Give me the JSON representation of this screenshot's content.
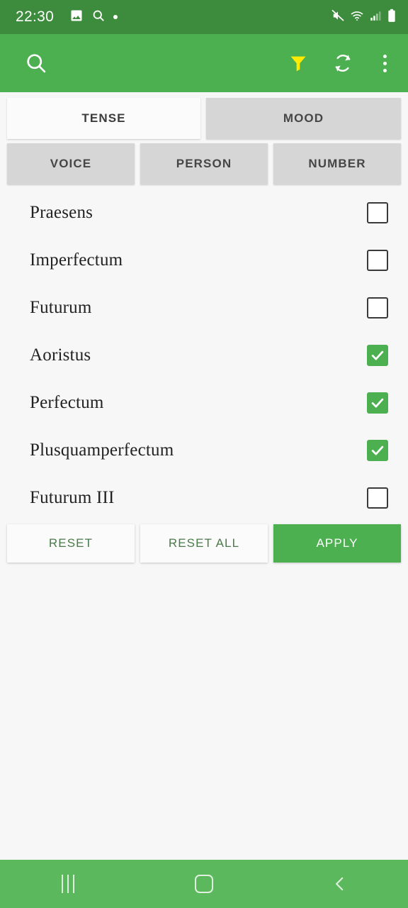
{
  "status_bar": {
    "time": "22:30",
    "left_icons": [
      "image-icon",
      "search-icon",
      "dot-indicator"
    ],
    "right_icons": [
      "mute-icon",
      "wifi-icon",
      "signal-icon",
      "battery-icon"
    ],
    "background_color": "#3d8b3d"
  },
  "app_bar": {
    "background_color": "#4caf50",
    "search_icon": "search-icon",
    "filter_icon": "filter-funnel-icon",
    "filter_color": "#ffeb00",
    "refresh_icon": "refresh-icon",
    "overflow_icon": "overflow-menu-icon"
  },
  "tabs": {
    "row1": [
      {
        "label": "TENSE",
        "selected": true
      },
      {
        "label": "MOOD",
        "selected": false
      }
    ],
    "row2": [
      {
        "label": "VOICE",
        "selected": false
      },
      {
        "label": "PERSON",
        "selected": false
      },
      {
        "label": "NUMBER",
        "selected": false
      }
    ]
  },
  "options": [
    {
      "label": "Praesens",
      "checked": false
    },
    {
      "label": "Imperfectum",
      "checked": false
    },
    {
      "label": "Futurum",
      "checked": false
    },
    {
      "label": "Aoristus",
      "checked": true
    },
    {
      "label": "Perfectum",
      "checked": true
    },
    {
      "label": "Plusquamperfectum",
      "checked": true
    },
    {
      "label": "Futurum III",
      "checked": false
    }
  ],
  "actions": [
    {
      "label": "RESET",
      "primary": false
    },
    {
      "label": "RESET ALL",
      "primary": false
    },
    {
      "label": "APPLY",
      "primary": true
    }
  ],
  "nav_bar": {
    "background_color": "#5cb85c",
    "recents_label": "recents-icon",
    "home_label": "home-icon",
    "back_label": "back-icon"
  },
  "colors": {
    "accent_green": "#4caf50",
    "status_green": "#3d8b3d",
    "nav_green": "#5cb85c",
    "filter_yellow": "#ffeb00",
    "tab_unselected": "#d6d6d6",
    "tab_selected": "#fbfbfb",
    "page_background": "#f7f7f7"
  }
}
